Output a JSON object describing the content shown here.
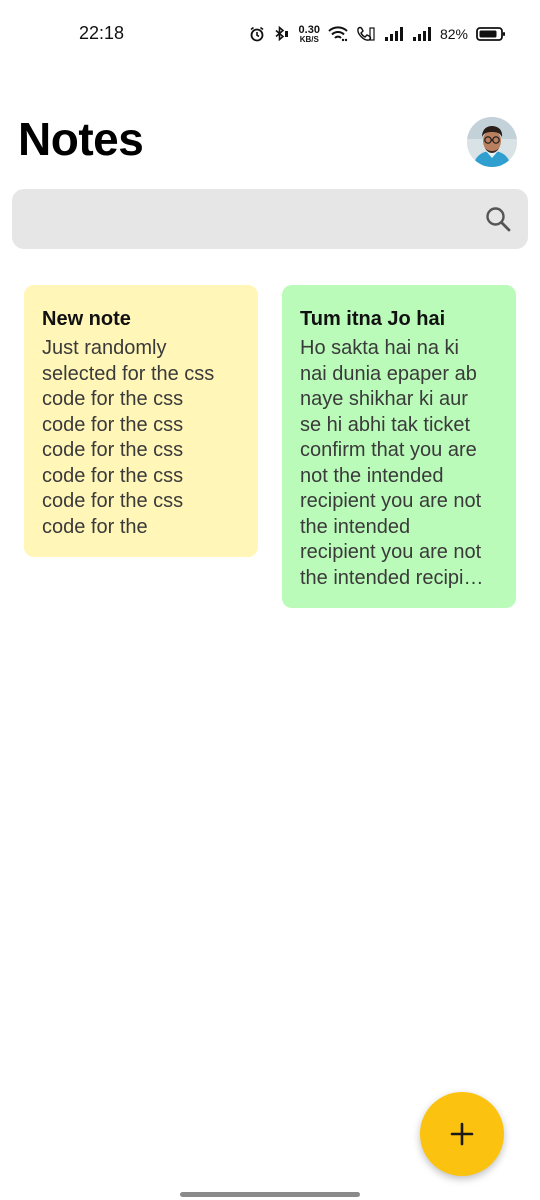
{
  "status_bar": {
    "time": "22:18",
    "net_speed_value": "0.30",
    "net_speed_unit": "KB/S",
    "battery": "82%",
    "icons": [
      "alarm-icon",
      "bluetooth-icon",
      "wifi-icon",
      "call-icon",
      "signal-icon",
      "signal-icon",
      "battery-icon"
    ]
  },
  "header": {
    "title": "Notes"
  },
  "search": {
    "placeholder": "",
    "icon": "search-icon"
  },
  "notes": [
    {
      "title": "New note",
      "body": "Just randomly\nselected for the css\ncode for the css\ncode for the css\ncode for the css\ncode for the css\ncode for the css\ncode for the",
      "color": "#fff6b8"
    },
    {
      "title": "Tum itna Jo hai",
      "body": "Ho sakta hai na ki\nnai dunia epaper ab\nnaye shikhar ki aur\nse hi abhi tak ticket\nconfirm that you are\nnot the intended\nrecipient you are not\nthe intended\nrecipient you are not\nthe intended recipi…",
      "color": "#bafbba"
    }
  ],
  "fab": {
    "icon": "plus-icon",
    "color": "#fbc30f"
  }
}
